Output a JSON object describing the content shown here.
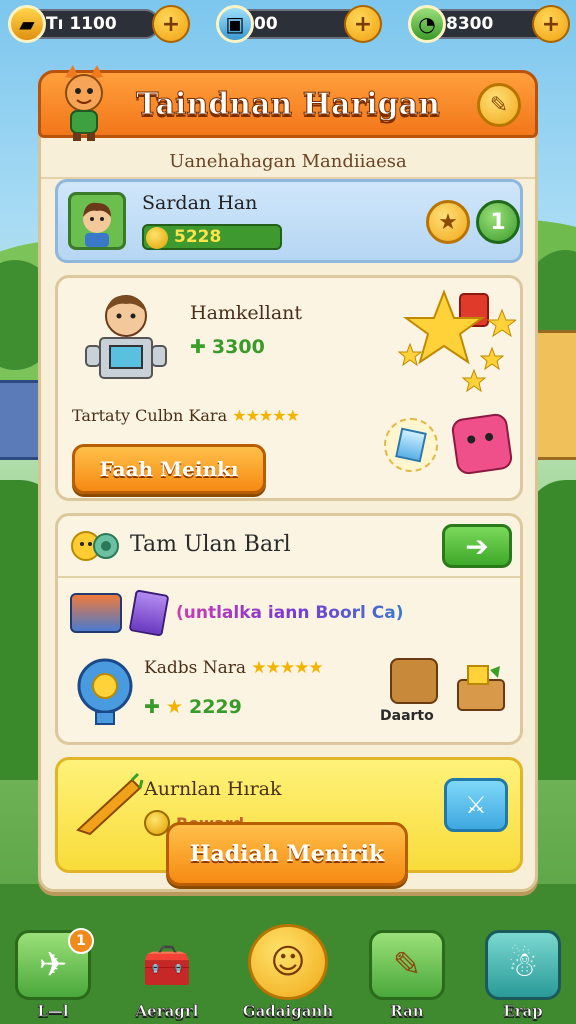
{
  "resources": [
    {
      "id": "gold",
      "value": "Tı 1100",
      "icon": "gold-bar-icon",
      "color": "#f2a21a"
    },
    {
      "id": "gem",
      "value": "00",
      "icon": "gem-tablet-icon",
      "color": "#3aa8d8"
    },
    {
      "id": "energy",
      "value": "8300",
      "icon": "clock-gem-icon",
      "color": "#3fae3a"
    }
  ],
  "panel": {
    "title": "Taindnan Harigan",
    "subtitle": "Uanehahagan Mandiiaesa"
  },
  "player": {
    "name": "Sardan Han",
    "xp": "5228",
    "level": "1"
  },
  "card_a": {
    "title": "Hamkellant",
    "reward": "3300",
    "description": "Tartaty Culbn Kara",
    "rating": "★★★★★",
    "button": "Faah Meinkı"
  },
  "card_b": {
    "header": "Tam Ulan Barl",
    "promo": "(untlalka iann Boorl Ca)",
    "item_title": "Kadbs Nara",
    "rating": "★★★★★",
    "reward": "2229",
    "box_label": "Daarto"
  },
  "card_c": {
    "title": "Aurnlan Hırak",
    "subtitle": "Reward",
    "button": "Hadiah Menirik"
  },
  "nav": [
    {
      "label": "L—l",
      "badge": "1"
    },
    {
      "label": "Aeragrl"
    },
    {
      "label": "Gadaiganh"
    },
    {
      "label": "Ran"
    },
    {
      "label": "Erap"
    }
  ]
}
